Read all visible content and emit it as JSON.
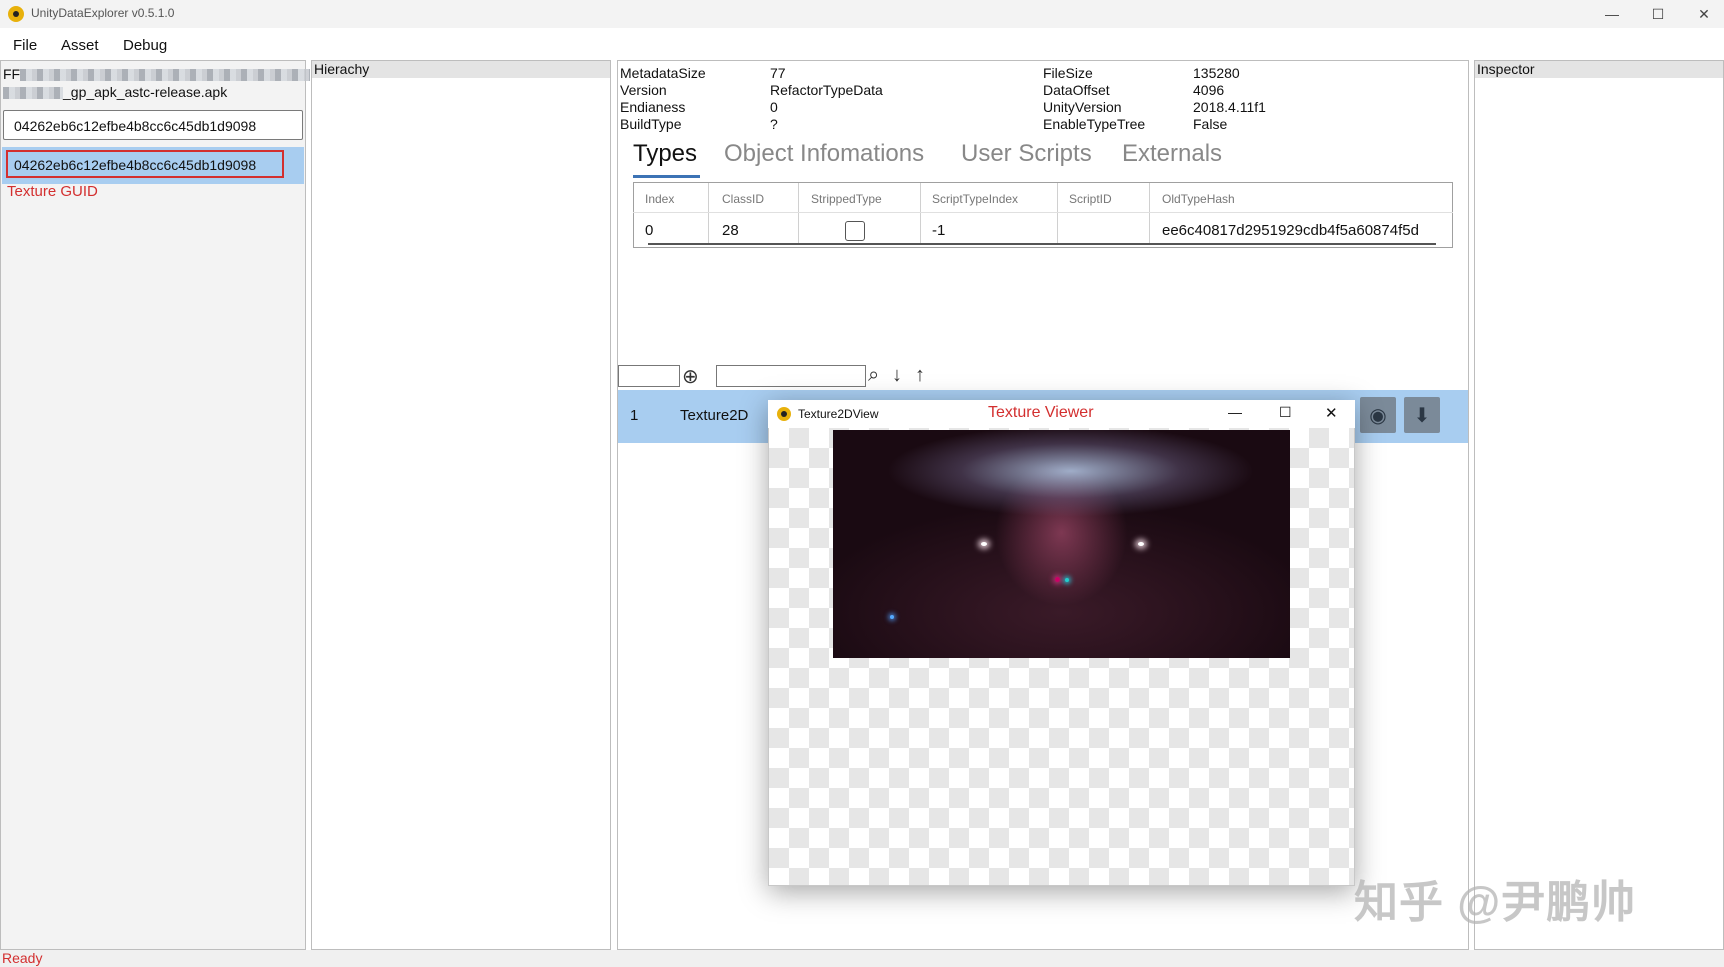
{
  "app": {
    "title": "UnityDataExplorer v0.5.1.0"
  },
  "window_controls": {
    "minimize": "—",
    "maximize": "☐",
    "close": "✕"
  },
  "menu": {
    "items": [
      "File",
      "Asset",
      "Debug"
    ]
  },
  "left": {
    "path_prefix": "FF",
    "path_suffix": "_gp_apk_astc-release.apk",
    "search_value": "04262eb6c12efbe4b8cc6c45db1d9098",
    "result": "04262eb6c12efbe4b8cc6c45db1d9098",
    "annotation": "Texture GUID"
  },
  "hierarchy": {
    "header": "Hierachy"
  },
  "inspector": {
    "header": "Inspector"
  },
  "meta_left": [
    {
      "key": "MetadataSize",
      "value": "77"
    },
    {
      "key": "Version",
      "value": "RefactorTypeData"
    },
    {
      "key": "Endianess",
      "value": "0"
    },
    {
      "key": "BuildType",
      "value": "?"
    }
  ],
  "meta_right": [
    {
      "key": "FileSize",
      "value": "135280"
    },
    {
      "key": "DataOffset",
      "value": "4096"
    },
    {
      "key": "UnityVersion",
      "value": "2018.4.11f1"
    },
    {
      "key": "EnableTypeTree",
      "value": "False"
    }
  ],
  "tabs": [
    "Types",
    "Object Infomations",
    "User Scripts",
    "Externals"
  ],
  "types_table": {
    "columns": [
      "Index",
      "ClassID",
      "StrippedType",
      "ScriptTypeIndex",
      "ScriptID",
      "OldTypeHash"
    ],
    "row": {
      "Index": "0",
      "ClassID": "28",
      "StrippedType": false,
      "ScriptTypeIndex": "-1",
      "ScriptID": "",
      "OldTypeHash": "ee6c40817d2951929cdb4f5a60874f5d"
    }
  },
  "object_row": {
    "index": "1",
    "type": "Texture2D"
  },
  "texture_window": {
    "title": "Texture2DView",
    "annotation": "Texture Viewer"
  },
  "status": {
    "text": "Ready"
  },
  "watermark": "知乎 @尹鹏帅"
}
